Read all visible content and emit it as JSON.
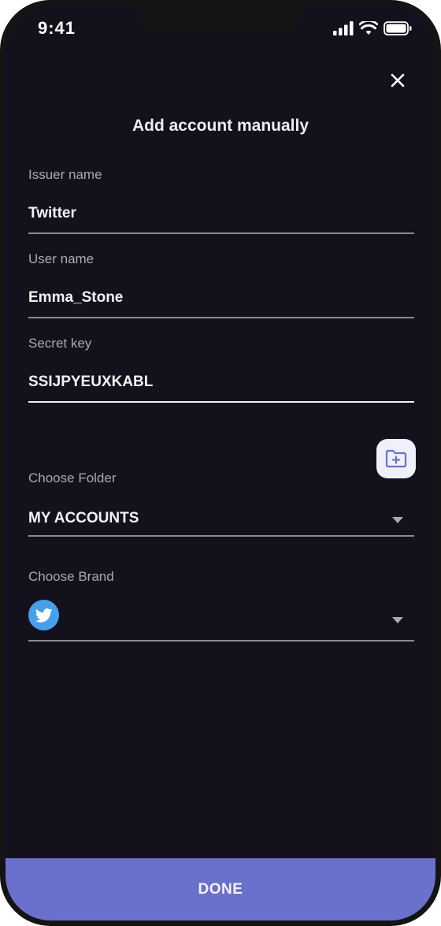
{
  "status_bar": {
    "time": "9:41"
  },
  "header": {
    "title": "Add account manually",
    "close_icon": "close-icon"
  },
  "form": {
    "issuer": {
      "label": "Issuer name",
      "value": "Twitter"
    },
    "user": {
      "label": "User name",
      "value": "Emma_Stone"
    },
    "secret": {
      "label": "Secret key",
      "value": "SSIJPYEUXKABL"
    },
    "folder": {
      "label": "Choose Folder",
      "value": "MY ACCOUNTS"
    },
    "brand": {
      "label": "Choose Brand",
      "icon": "twitter-bird-icon"
    }
  },
  "actions": {
    "add_folder_icon": "folder-plus-icon",
    "done_label": "DONE"
  },
  "colors": {
    "background": "#13121c",
    "accent": "#6a70cc",
    "brand_twitter": "#46a1ea"
  }
}
